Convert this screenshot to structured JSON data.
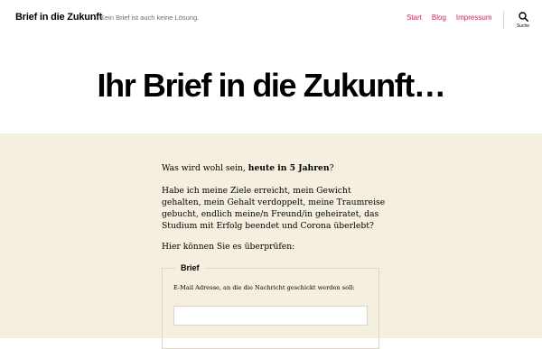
{
  "header": {
    "site_title": "Brief in die Zukunft",
    "site_description": "Kein Brief ist auch keine Lösung.",
    "nav": [
      {
        "label": "Start"
      },
      {
        "label": "Blog"
      },
      {
        "label": "Impressum"
      }
    ],
    "search": {
      "label": "Suche",
      "icon": "search-icon"
    }
  },
  "hero": {
    "title": "Ihr Brief in die Zukunft…"
  },
  "entry": {
    "p1_before": "Was wird wohl sein, ",
    "p1_bold": "heute in 5 Jahren",
    "p1_after": "?",
    "p2": "Habe ich meine Ziele erreicht, mein Gewicht gehalten, mein Gehalt verdoppelt, meine Traumreise gebucht, endlich meine/n Freund/in geheiratet, das Studium mit Erfolg beendet und Corona überlebt?",
    "p3": "Hier können Sie es überprüfen:"
  },
  "form": {
    "legend": "Brief",
    "email_label": "E-Mail Adresse, an die die Nachricht geschickt werden soll:",
    "email_value": ""
  },
  "colors": {
    "accent": "#cd2653",
    "content_background": "#f5efe0",
    "border": "#dcd7ca"
  }
}
